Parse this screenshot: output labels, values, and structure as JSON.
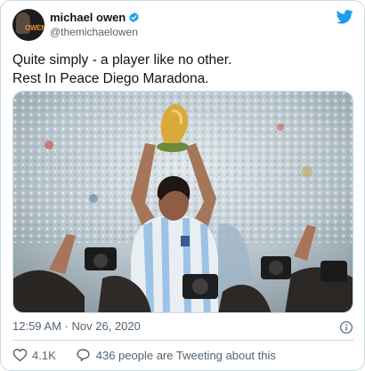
{
  "author": {
    "display_name": "michael owen",
    "handle": "@themichaelowen",
    "avatar_text": "OWEN",
    "verified_icon": "verified-badge-icon"
  },
  "platform_icon": "twitter-bird-icon",
  "tweet": {
    "lines": [
      "Quite simply - a player like no other.",
      "Rest In Peace Diego Maradona."
    ]
  },
  "media": {
    "icon": "photo"
  },
  "meta": {
    "timestamp": "12:59 AM · Nov 26, 2020",
    "info_icon": "info-icon"
  },
  "actions": {
    "like_icon": "heart-icon",
    "like_count": "4.1K",
    "reply_icon": "speech-bubble-icon",
    "tweeting_text": "436 people are Tweeting about this"
  },
  "colors": {
    "brand_blue": "#1d9bf0",
    "text_primary": "#0f1419",
    "text_secondary": "#536471",
    "border": "#cfd9de"
  }
}
